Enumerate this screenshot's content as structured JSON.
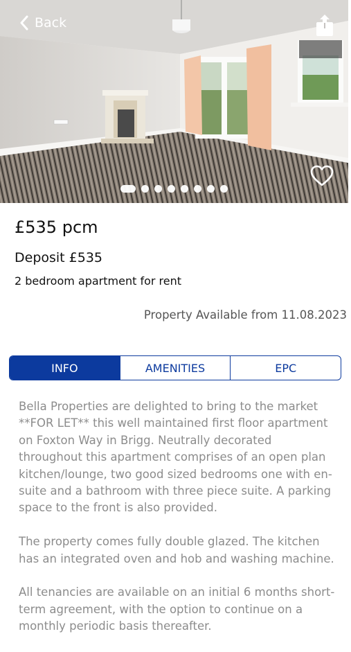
{
  "header": {
    "back_label": "Back",
    "back_icon": "chevron-left-icon",
    "share_icon": "share-icon",
    "favorite_icon": "heart-outline-icon"
  },
  "gallery": {
    "image_count": 8,
    "active_index": 0
  },
  "listing": {
    "price": "£535 pcm",
    "deposit": "Deposit £535",
    "summary": "2 bedroom apartment for rent",
    "availability": "Property Available from 11.08.2023"
  },
  "tabs": [
    {
      "label": "INFO",
      "active": true
    },
    {
      "label": "AMENITIES",
      "active": false
    },
    {
      "label": "EPC",
      "active": false
    }
  ],
  "description": [
    "Bella Properties are delighted to bring to the market **FOR LET** this well maintained first floor apartment on Foxton Way in Brigg. Neutrally decorated throughout this apartment comprises of an open plan kitchen/lounge, two good sized bedrooms one with en-suite and a bathroom with three piece suite. A parking space to the front is also provided.",
    "The property comes fully double glazed. The kitchen has an integrated oven and hob and washing machine.",
    "All tenancies are available on an initial 6 months short-term agreement, with the option to continue on a monthly periodic basis thereafter."
  ],
  "colors": {
    "accent": "#0c3a9e",
    "body_text": "#8c8c8c"
  }
}
